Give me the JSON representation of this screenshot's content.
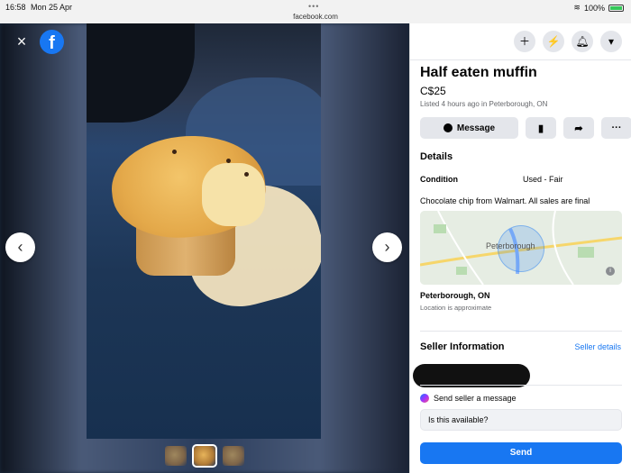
{
  "status": {
    "time": "16:58",
    "date": "Mon 25 Apr",
    "url": "facebook.com",
    "battery": "100%"
  },
  "viewer": {
    "close_icon": "×",
    "logo_letter": "f",
    "prev_icon": "‹",
    "next_icon": "›",
    "thumbnails": [
      {
        "active": false
      },
      {
        "active": true
      },
      {
        "active": false
      }
    ]
  },
  "panel": {
    "top_icons": [
      "plus-icon",
      "messenger-icon",
      "bell-icon",
      "caret-down-icon"
    ],
    "title": "Half eaten muffin",
    "price": "C$25",
    "listed": "Listed 4 hours ago in Peterborough, ON",
    "actions": {
      "message_label": "Message",
      "save_icon": "bookmark-icon",
      "share_icon": "share-icon",
      "more_icon": "more-icon"
    },
    "details_heading": "Details",
    "condition_label": "Condition",
    "condition_value": "Used - Fair",
    "description": "Chocolate chip from Walmart. All sales are final",
    "map_label": "Peterborough",
    "location_name": "Peterborough, ON",
    "location_note": "Location is approximate",
    "seller_heading": "Seller Information",
    "seller_link": "Seller details",
    "send_seller_label": "Send seller a message",
    "message_input_value": "Is this available?",
    "send_label": "Send"
  },
  "colors": {
    "accent": "#1877f2",
    "secondary_text": "#65676b"
  }
}
